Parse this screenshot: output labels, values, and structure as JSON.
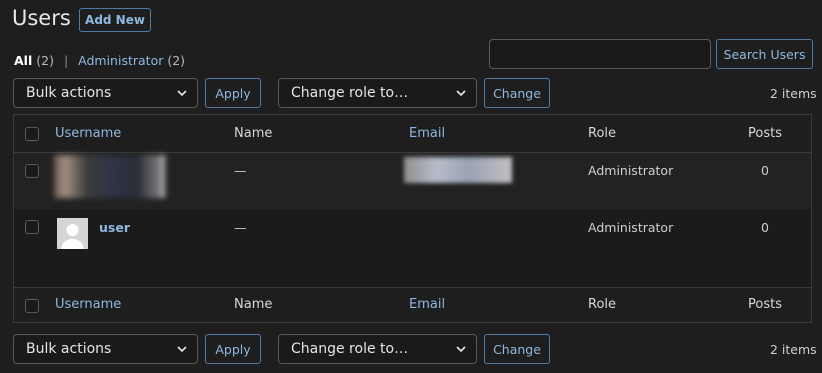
{
  "page": {
    "title": "Users",
    "add_new_label": "Add New"
  },
  "filters": {
    "all_label": "All",
    "all_count": "(2)",
    "separator": "|",
    "admin_label": "Administrator",
    "admin_count": "(2)"
  },
  "search": {
    "value": "",
    "button_label": "Search Users"
  },
  "bulk_top": {
    "bulk_select": "Bulk actions",
    "apply_label": "Apply",
    "role_select": "Change role to…",
    "change_label": "Change",
    "items_count": "2 items"
  },
  "bulk_bottom": {
    "bulk_select": "Bulk actions",
    "apply_label": "Apply",
    "role_select": "Change role to…",
    "change_label": "Change",
    "items_count": "2 items"
  },
  "table": {
    "columns": [
      "Username",
      "Name",
      "Email",
      "Role",
      "Posts"
    ],
    "rows": [
      {
        "username": "",
        "name": "—",
        "email": "",
        "role": "Administrator",
        "posts": "0"
      },
      {
        "username": "user",
        "name": "—",
        "email": "",
        "role": "Administrator",
        "posts": "0"
      }
    ]
  },
  "colors": {
    "background": "#1e1e1e",
    "link": "#8fb8e0",
    "border": "#3a3a3a",
    "button_border": "#4f7aa3"
  },
  "icons": {
    "select_chevron": "chevron-down-icon",
    "default_avatar": "user-silhouette-icon"
  }
}
